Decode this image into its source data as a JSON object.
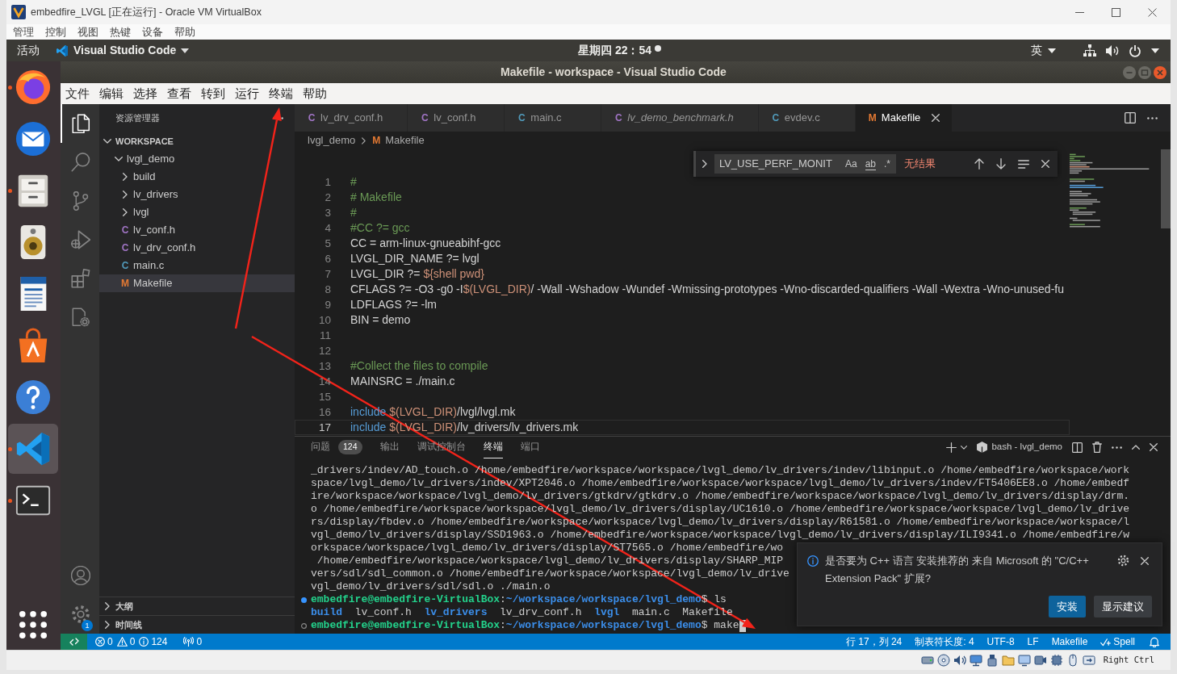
{
  "host_window": {
    "title": "embedfire_LVGL [正在运行] - Oracle VM VirtualBox",
    "menu": [
      "管理",
      "控制",
      "视图",
      "热键",
      "设备",
      "帮助"
    ],
    "status_indicators": [
      {
        "kind": "disk"
      },
      {
        "kind": "optical"
      },
      {
        "kind": "audio"
      },
      {
        "kind": "network"
      },
      {
        "kind": "usb"
      },
      {
        "kind": "shared"
      },
      {
        "kind": "display"
      },
      {
        "kind": "recording"
      },
      {
        "kind": "cpu"
      },
      {
        "kind": "mouse"
      },
      {
        "kind": "keyboard"
      }
    ],
    "host_key": "Right Ctrl"
  },
  "top_bar": {
    "activities": "活动",
    "app_menu": "Visual Studio Code",
    "clock": "星期四 22：54",
    "has_notifications": true,
    "input_method": "英"
  },
  "dock": {
    "apps": [
      {
        "kind": "browser",
        "running": true,
        "focused": false
      },
      {
        "kind": "mail",
        "running": false,
        "focused": false
      },
      {
        "kind": "files",
        "running": true,
        "focused": false
      },
      {
        "kind": "music",
        "running": false,
        "focused": false
      },
      {
        "kind": "writer",
        "running": false,
        "focused": false
      },
      {
        "kind": "store",
        "running": false,
        "focused": false
      },
      {
        "kind": "help",
        "running": false,
        "focused": false
      },
      {
        "kind": "editor",
        "running": true,
        "focused": true
      },
      {
        "kind": "terminal",
        "running": true,
        "focused": false
      }
    ]
  },
  "vscode": {
    "title": "Makefile - workspace - Visual Studio Code",
    "menu": [
      "文件",
      "编辑",
      "选择",
      "查看",
      "转到",
      "运行",
      "终端",
      "帮助"
    ],
    "activity_bar": {
      "items": [
        {
          "kind": "explorer",
          "selected": true
        },
        {
          "kind": "search",
          "selected": false
        },
        {
          "kind": "scm",
          "selected": false
        },
        {
          "kind": "debug",
          "selected": false
        },
        {
          "kind": "extensions",
          "selected": false
        },
        {
          "kind": "remote",
          "selected": false
        }
      ],
      "bottom_items": [
        {
          "kind": "accounts"
        },
        {
          "kind": "manage",
          "badge": "1"
        }
      ]
    },
    "sidebar": {
      "title": "资源管理器",
      "sections": [
        {
          "title": "WORKSPACE",
          "expanded": true,
          "tree": [
            {
              "kind": "folder",
              "label": "lvgl_demo",
              "expanded": true,
              "selected": false,
              "children": [
                {
                  "kind": "folder",
                  "label": "build",
                  "expanded": false,
                  "selected": false
                },
                {
                  "kind": "folder",
                  "label": "lv_drivers",
                  "expanded": false,
                  "selected": false
                },
                {
                  "kind": "folder",
                  "label": "lvgl",
                  "expanded": false,
                  "selected": false
                },
                {
                  "kind": "file",
                  "icon": "C",
                  "color": "#a074c4",
                  "label": "lv_conf.h",
                  "selected": false
                },
                {
                  "kind": "file",
                  "icon": "C",
                  "color": "#a074c4",
                  "label": "lv_drv_conf.h",
                  "selected": false
                },
                {
                  "kind": "file",
                  "icon": "C",
                  "color": "#519aba",
                  "label": "main.c",
                  "selected": false
                },
                {
                  "kind": "file",
                  "icon": "M",
                  "color": "#e37933",
                  "label": "Makefile",
                  "selected": true
                }
              ]
            }
          ]
        },
        {
          "title": "大纲",
          "expanded": false
        },
        {
          "title": "时间线",
          "expanded": false
        }
      ]
    },
    "tabs": [
      {
        "icon": "C",
        "color": "#a074c4",
        "label": "lv_drv_conf.h",
        "preview": false,
        "selected": false
      },
      {
        "icon": "C",
        "color": "#a074c4",
        "label": "lv_conf.h",
        "preview": false,
        "selected": false
      },
      {
        "icon": "C",
        "color": "#519aba",
        "label": "main.c",
        "preview": false,
        "selected": false
      },
      {
        "icon": "C",
        "color": "#a074c4",
        "label": "lv_demo_benchmark.h",
        "preview": true,
        "selected": false
      },
      {
        "icon": "C",
        "color": "#519aba",
        "label": "evdev.c",
        "preview": false,
        "selected": false
      },
      {
        "icon": "M",
        "color": "#e37933",
        "label": "Makefile",
        "preview": false,
        "selected": true
      }
    ],
    "breadcrumbs": [
      {
        "label": "lvgl_demo"
      },
      {
        "icon": "M",
        "color": "#e37933",
        "label": "Makefile"
      }
    ],
    "find_widget": {
      "query": "LV_USE_PERF_MONIT",
      "options": [
        {
          "kind": "case",
          "label": "Aa",
          "on": false
        },
        {
          "kind": "word",
          "label": "ab",
          "on": false
        },
        {
          "kind": "regex",
          "label": ".*",
          "on": false
        }
      ],
      "result": "无结果"
    },
    "editor": {
      "lines": [
        {
          "number": "1",
          "current": false,
          "tokens": [
            {
              "kind": "comment",
              "text": "#"
            }
          ]
        },
        {
          "number": "2",
          "current": false,
          "tokens": [
            {
              "kind": "comment",
              "text": "# Makefile"
            }
          ]
        },
        {
          "number": "3",
          "current": false,
          "tokens": [
            {
              "kind": "comment",
              "text": "#"
            }
          ]
        },
        {
          "number": "4",
          "current": false,
          "tokens": [
            {
              "kind": "comment",
              "text": "#CC ?= gcc"
            }
          ]
        },
        {
          "number": "5",
          "current": false,
          "tokens": [
            {
              "kind": "plain",
              "text": "CC = arm-linux-gnueabihf-gcc"
            }
          ]
        },
        {
          "number": "6",
          "current": false,
          "tokens": [
            {
              "kind": "plain",
              "text": "LVGL_DIR_NAME ?= lvgl"
            }
          ]
        },
        {
          "number": "7",
          "current": false,
          "tokens": [
            {
              "kind": "plain",
              "text": "LVGL_DIR ?= "
            },
            {
              "kind": "variable",
              "text": "${shell pwd}"
            }
          ]
        },
        {
          "number": "8",
          "current": false,
          "tokens": [
            {
              "kind": "plain",
              "text": "CFLAGS ?= -O3 -g0 -I"
            },
            {
              "kind": "variable",
              "text": "$(LVGL_DIR)"
            },
            {
              "kind": "plain",
              "text": "/ -Wall -Wshadow -Wundef -Wmissing-prototypes -Wno-discarded-qualifiers -Wall -Wextra -Wno-unused-fu"
            }
          ]
        },
        {
          "number": "9",
          "current": false,
          "tokens": [
            {
              "kind": "plain",
              "text": "LDFLAGS ?= -lm"
            }
          ]
        },
        {
          "number": "10",
          "current": false,
          "tokens": [
            {
              "kind": "plain",
              "text": "BIN = demo"
            }
          ]
        },
        {
          "number": "11",
          "current": false
        },
        {
          "number": "12",
          "current": false
        },
        {
          "number": "13",
          "current": false,
          "tokens": [
            {
              "kind": "comment",
              "text": "#Collect the files to compile"
            }
          ]
        },
        {
          "number": "14",
          "current": false,
          "tokens": [
            {
              "kind": "plain",
              "text": "MAINSRC = ./main.c"
            }
          ]
        },
        {
          "number": "15",
          "current": false
        },
        {
          "number": "16",
          "current": false,
          "tokens": [
            {
              "kind": "keyword",
              "text": "include "
            },
            {
              "kind": "variable",
              "text": "$(LVGL_DIR)"
            },
            {
              "kind": "plain",
              "text": "/lvgl/lvgl.mk"
            }
          ]
        },
        {
          "number": "17",
          "current": true,
          "tokens": [
            {
              "kind": "keyword",
              "text": "include "
            },
            {
              "kind": "variable",
              "text": "$(LVGL_DIR)"
            },
            {
              "kind": "plain",
              "text": "/lv_drivers/lv_drivers.mk"
            }
          ]
        }
      ]
    },
    "panel": {
      "tabs": [
        {
          "label": "问题",
          "badge": "124",
          "selected": false
        },
        {
          "label": "输出",
          "selected": false
        },
        {
          "label": "调试控制台",
          "selected": false
        },
        {
          "label": "终端",
          "selected": true
        },
        {
          "label": "端口",
          "selected": false
        }
      ],
      "terminal_name": "bash - lvgl_demo",
      "terminal_lines": [
        {
          "kind": "output",
          "cursor": false,
          "tokens": [
            {
              "kind": "plain",
              "text": "_drivers/indev/AD_touch.o /home/embedfire/workspace/workspace/lvgl_demo/lv_drivers/indev/libinput.o /home/embedfire/workspace/work"
            }
          ]
        },
        {
          "kind": "output",
          "cursor": false,
          "tokens": [
            {
              "kind": "plain",
              "text": "space/lvgl_demo/lv_drivers/indev/XPT2046.o /home/embedfire/workspace/workspace/lvgl_demo/lv_drivers/indev/FT5406EE8.o /home/embedf"
            }
          ]
        },
        {
          "kind": "output",
          "cursor": false,
          "tokens": [
            {
              "kind": "plain",
              "text": "ire/workspace/workspace/lvgl_demo/lv_drivers/gtkdrv/gtkdrv.o /home/embedfire/workspace/workspace/lvgl_demo/lv_drivers/display/drm."
            }
          ]
        },
        {
          "kind": "output",
          "cursor": false,
          "tokens": [
            {
              "kind": "plain",
              "text": "o /home/embedfire/workspace/workspace/lvgl_demo/lv_drivers/display/UC1610.o /home/embedfire/workspace/workspace/lvgl_demo/lv_drive"
            }
          ]
        },
        {
          "kind": "output",
          "cursor": false,
          "tokens": [
            {
              "kind": "plain",
              "text": "rs/display/fbdev.o /home/embedfire/workspace/workspace/lvgl_demo/lv_drivers/display/R61581.o /home/embedfire/workspace/workspace/l"
            }
          ]
        },
        {
          "kind": "output",
          "cursor": false,
          "tokens": [
            {
              "kind": "plain",
              "text": "vgl_demo/lv_drivers/display/SSD1963.o /home/embedfire/workspace/workspace/lvgl_demo/lv_drivers/display/ILI9341.o /home/embedfire/w"
            }
          ]
        },
        {
          "kind": "output",
          "cursor": false,
          "tokens": [
            {
              "kind": "plain",
              "text": "orkspace/workspace/lvgl_demo/lv_drivers/display/ST7565.o /home/embedfire/wo"
            }
          ]
        },
        {
          "kind": "output",
          "cursor": false,
          "tokens": [
            {
              "kind": "plain",
              "text": " /home/embedfire/workspace/workspace/lvgl_demo/lv_drivers/display/SHARP_MIP"
            }
          ]
        },
        {
          "kind": "output",
          "cursor": false,
          "tokens": [
            {
              "kind": "plain",
              "text": "vers/sdl/sdl_common.o /home/embedfire/workspace/workspace/lvgl_demo/lv_drive"
            }
          ]
        },
        {
          "kind": "output",
          "cursor": false,
          "tokens": [
            {
              "kind": "plain",
              "text": "vgl_demo/lv_drivers/sdl/sdl.o ./main.o"
            }
          ]
        },
        {
          "kind": "prompt",
          "succeeded": true,
          "cursor": false,
          "tokens": [
            {
              "kind": "user",
              "text": "embedfire@embedfire-VirtualBox"
            },
            {
              "kind": "plain",
              "text": ":"
            },
            {
              "kind": "path",
              "text": "~/workspace/workspace/lvgl_demo"
            },
            {
              "kind": "plain",
              "text": "$ ls"
            }
          ]
        },
        {
          "kind": "output",
          "cursor": false,
          "tokens": [
            {
              "kind": "dir",
              "text": "build"
            },
            {
              "kind": "plain",
              "text": "  lv_conf.h  "
            },
            {
              "kind": "dir",
              "text": "lv_drivers"
            },
            {
              "kind": "plain",
              "text": "  lv_drv_conf.h  "
            },
            {
              "kind": "dir",
              "text": "lvgl"
            },
            {
              "kind": "plain",
              "text": "  main.c  Makefile"
            }
          ]
        },
        {
          "kind": "prompt",
          "succeeded": false,
          "cursor": true,
          "tokens": [
            {
              "kind": "user",
              "text": "embedfire@embedfire-VirtualBox"
            },
            {
              "kind": "plain",
              "text": ":"
            },
            {
              "kind": "path",
              "text": "~/workspace/workspace/lvgl_demo"
            },
            {
              "kind": "plain",
              "text": "$ make"
            }
          ]
        }
      ]
    },
    "notification": {
      "message": "是否要为 C++ 语言 安装推荐的 来自 Microsoft 的 \"C/C++ Extension Pack\" 扩展?",
      "buttons": [
        {
          "label": "安装",
          "primary": true
        },
        {
          "label": "显示建议",
          "primary": false
        }
      ]
    },
    "status_bar": {
      "errors": "0",
      "warnings": "0",
      "infos": "124",
      "ports": "0",
      "items": [
        "行 17，列 24",
        "制表符长度: 4",
        "UTF-8",
        "LF",
        "Makefile"
      ],
      "spell": "Spell"
    }
  },
  "annotations": [
    {
      "kind": "arrow"
    },
    {
      "kind": "arrow"
    }
  ]
}
